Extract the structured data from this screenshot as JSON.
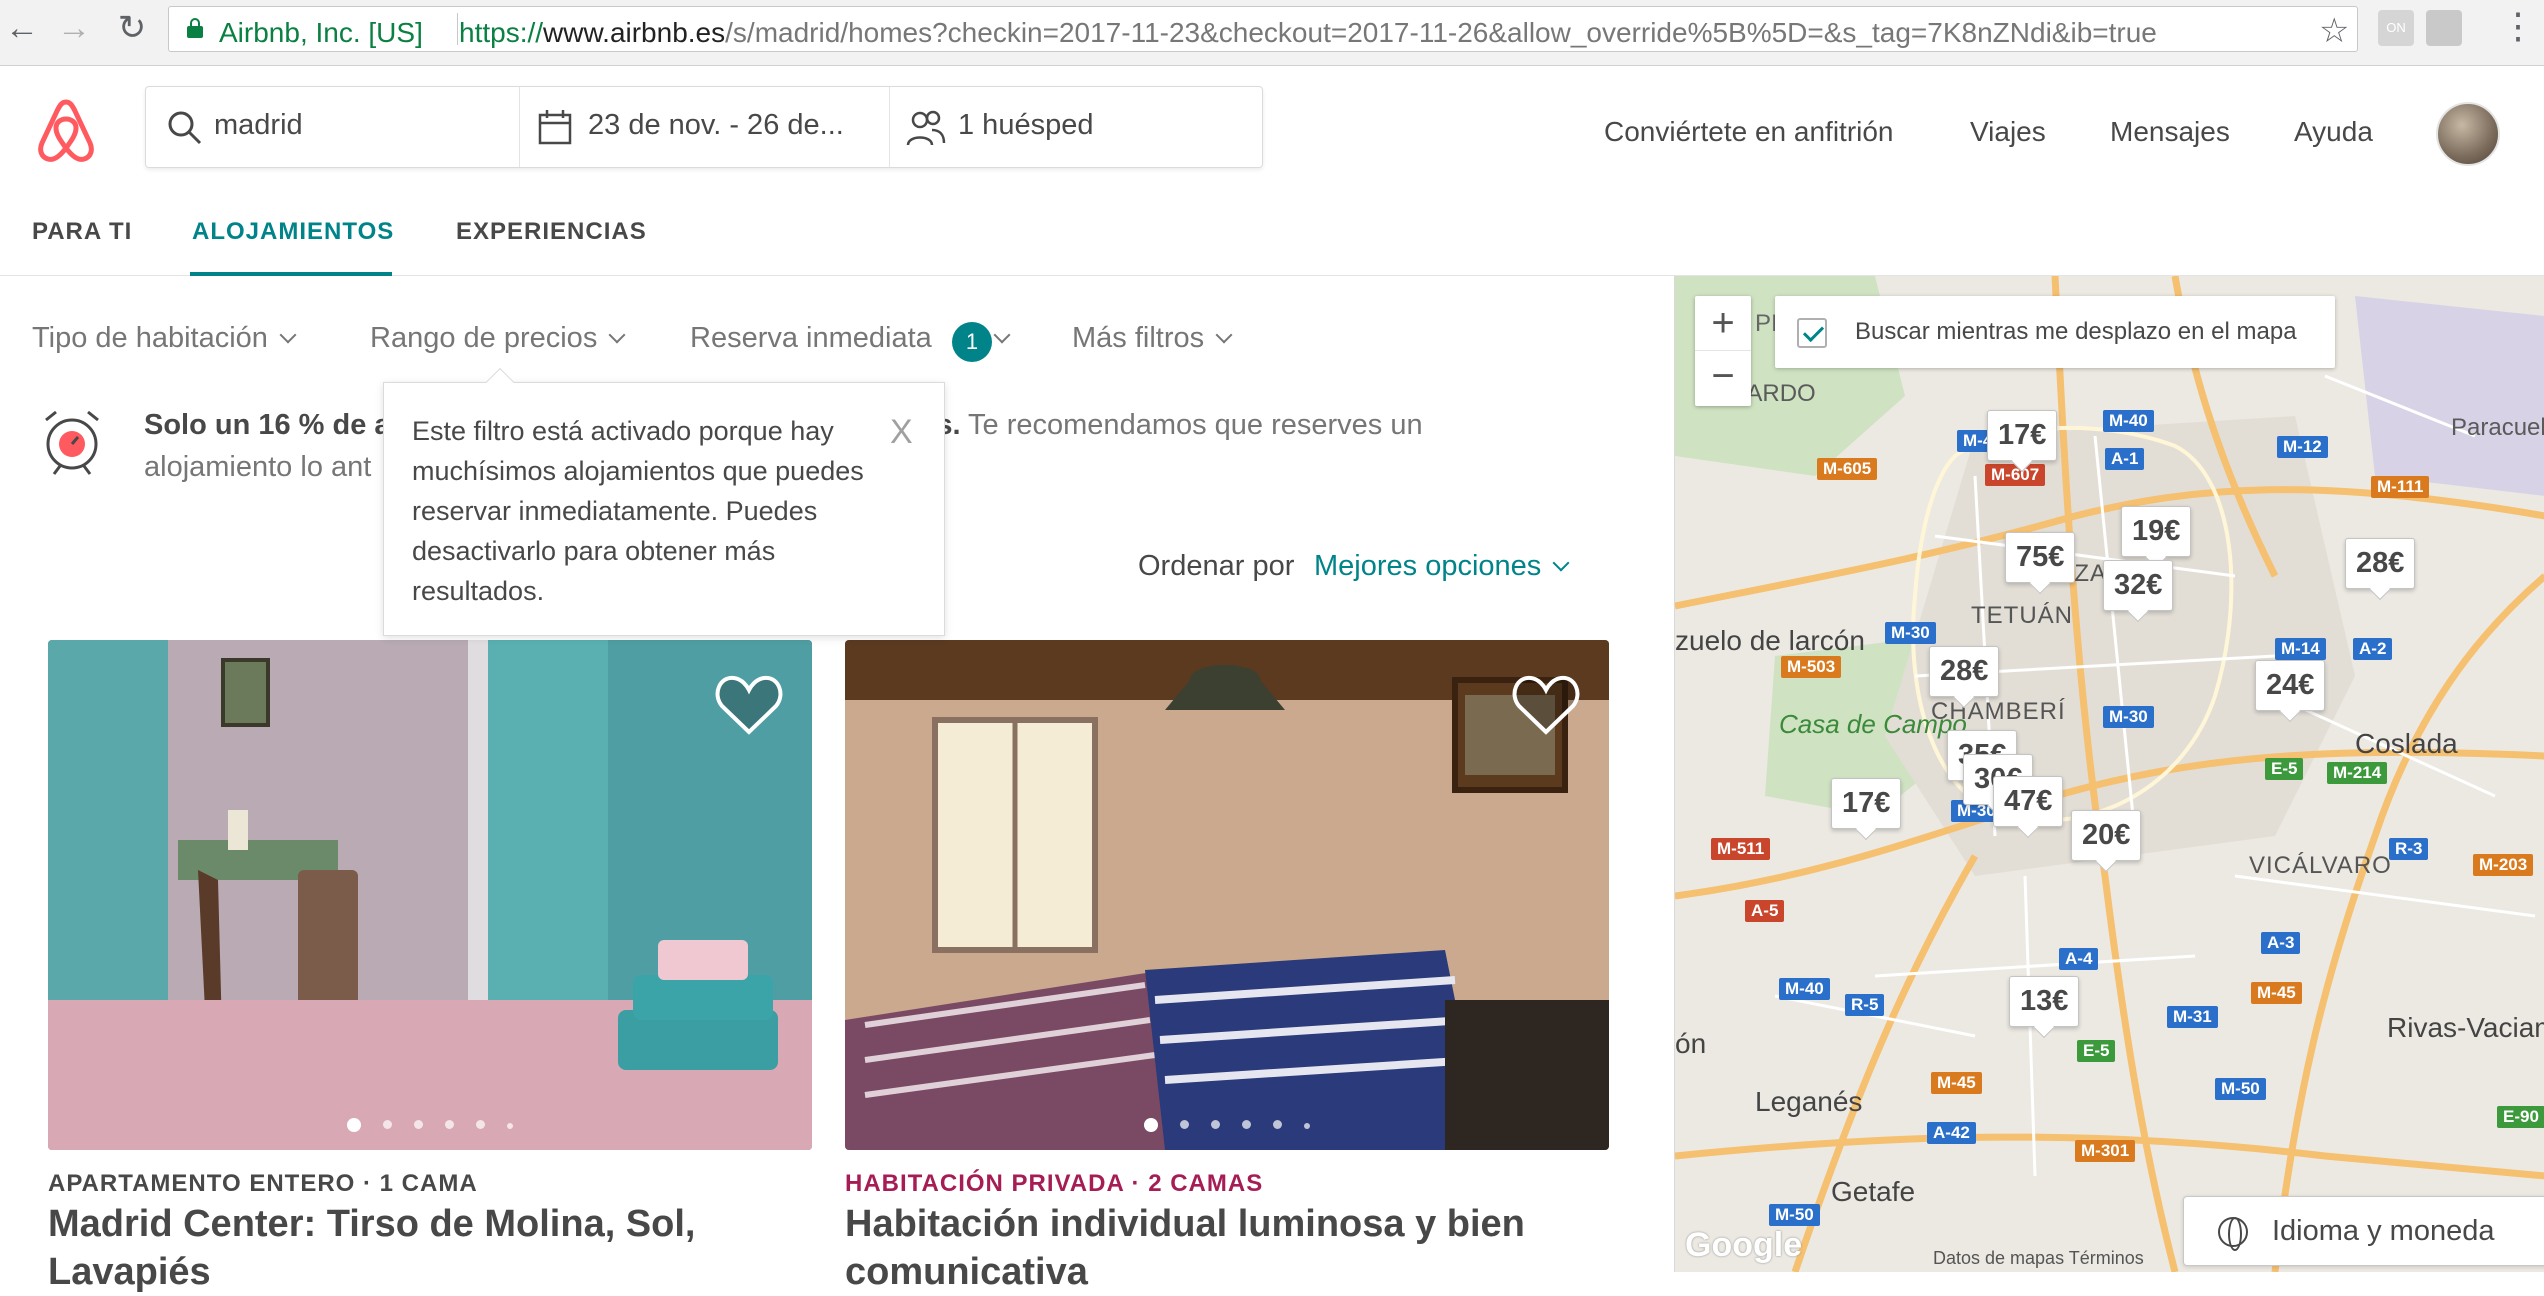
{
  "browser": {
    "site_name": "Airbnb, Inc. [US]",
    "url_prefix": "https://",
    "url_host": "www.airbnb.es",
    "url_path": "/s/madrid/homes?checkin=2017-11-23&checkout=2017-11-26&allow_override%5B%5D=&s_tag=7K8nZNdi&ib=true"
  },
  "search": {
    "location": "madrid",
    "dates": "23 de nov. - 26 de...",
    "guests": "1 huésped"
  },
  "topnav": {
    "host": "Conviértete en anfitrión",
    "trips": "Viajes",
    "messages": "Mensajes",
    "help": "Ayuda"
  },
  "tabs": [
    "PARA TI",
    "ALOJAMIENTOS",
    "EXPERIENCIAS"
  ],
  "filters": {
    "room_type": "Tipo de habitación",
    "price": "Rango de precios",
    "instant_book": "Reserva inmediata",
    "instant_book_count": "1",
    "more": "Más filtros"
  },
  "info": {
    "bold": "Solo un 16 % de a",
    "bold_tail": "fechas.",
    "text_tail": " Te recomendamos que reserves un",
    "line2": "alojamiento lo ant"
  },
  "tooltip": {
    "text": "Este filtro está activado porque hay muchísimos alojamientos que puedes reservar inmediatamente. Puedes desactivarlo para obtener más resultados.",
    "close": "X"
  },
  "sort": {
    "label": "Ordenar por",
    "value": "Mejores opciones"
  },
  "listings": [
    {
      "type": "APARTAMENTO ENTERO · 1 CAMA",
      "type_color": "#484848",
      "title": "Madrid Center: Tirso de Molina, Sol, Lavapiés"
    },
    {
      "type": "HABITACIÓN PRIVADA · 2 CAMAS",
      "type_color": "#a61d55",
      "title": "Habitación individual luminosa y bien comunicativa"
    }
  ],
  "map": {
    "search_checkbox": "Buscar mientras me desplazo en el mapa",
    "zoom_in": "+",
    "zoom_out": "−",
    "language_button": "Idioma y moneda",
    "footer": "Datos de mapas    Términos",
    "google": "Google",
    "prices": [
      "17€",
      "19€",
      "75€",
      "32€",
      "28€",
      "28€",
      "24€",
      "35€",
      "30€",
      "17€",
      "47€",
      "20€",
      "13€"
    ],
    "places": [
      "EL PARDO",
      "TETUÁN",
      "CHAMBERÍ",
      "Casa de Campo",
      "Coslada",
      "VICÁLVARO",
      "Rivas-Vaciam",
      "Leganés",
      "Getafe",
      "LEZA",
      "Paracuell de Jaran",
      "zuelo de larcón",
      "ón",
      "PI CA"
    ],
    "roads": [
      "M-40",
      "M-40",
      "M-607",
      "M-605",
      "A-1",
      "M-12",
      "M-111",
      "M-30",
      "M-503",
      "M-14",
      "A-2",
      "M-30",
      "E-5",
      "M-214",
      "M-511",
      "M-30",
      "A-5",
      "R-3",
      "M-203",
      "M-40",
      "R-5",
      "A-4",
      "A-3",
      "M-45",
      "M-31",
      "E-5",
      "M-50",
      "M-45",
      "A-42",
      "M-301",
      "M-50",
      "E-90"
    ]
  }
}
